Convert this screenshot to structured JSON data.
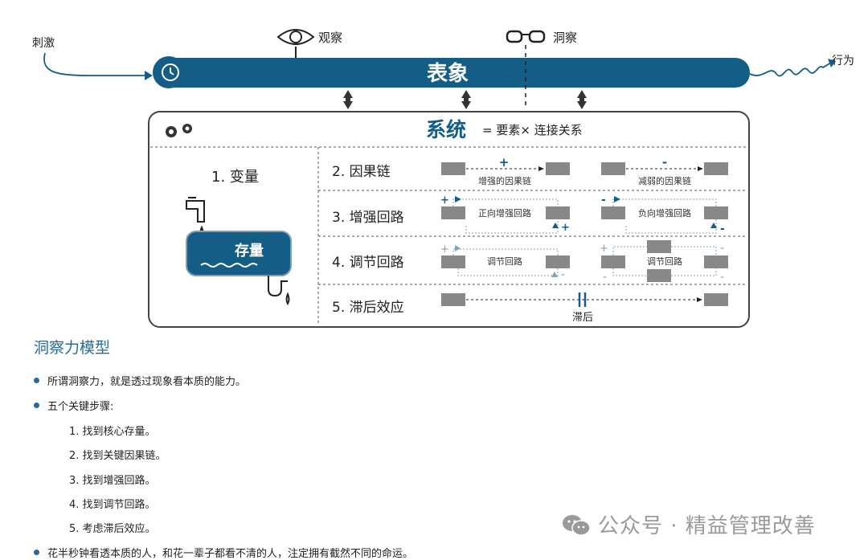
{
  "model": {
    "stimulus": "刺激",
    "observe": "观察",
    "insight": "洞察",
    "behavior": "行为",
    "phenomenon": "表象",
    "system_title": "系统",
    "system_formula": "= 要素× 连接关系",
    "variable": "1. 变量",
    "stock": "存量",
    "rows": [
      {
        "label": "2. 因果链",
        "left_caption": "增强的因果链",
        "left_sign": "+",
        "right_caption": "减弱的因果链",
        "right_sign": "-"
      },
      {
        "label": "3. 增强回路",
        "left_caption": "正向增强回路",
        "right_caption": "负向增强回路"
      },
      {
        "label": "4. 调节回路",
        "left_caption": "调节回路",
        "right_caption": "调节回路"
      },
      {
        "label": "5. 滞后效应",
        "delay_caption": "滞后"
      }
    ],
    "accent_color": "#135d86"
  },
  "article": {
    "title": "洞察力模型",
    "bullet1": "所谓洞察力，就是透过现象看本质的能力。",
    "bullet2": "五个关键步骤:",
    "steps": [
      "1. 找到核心存量。",
      "2. 找到关键因果链。",
      "3. 找到增强回路。",
      "4. 找到调节回路。",
      "5. 考虑滞后效应。"
    ],
    "bullet3": "花半秒钟看透本质的人，和花一辈子都看不清的人，注定拥有截然不同的命运。"
  },
  "watermark": "公众号 · 精益管理改善"
}
